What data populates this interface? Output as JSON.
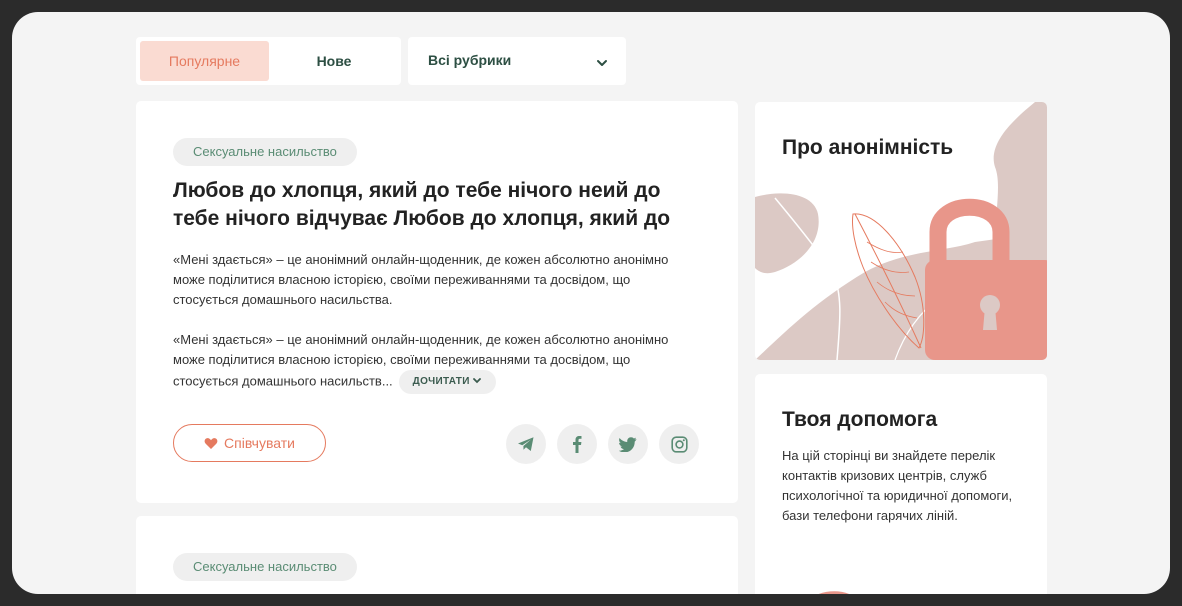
{
  "filters": {
    "tabs": [
      {
        "label": "Популярне",
        "active": true
      },
      {
        "label": "Нове",
        "active": false
      }
    ],
    "category_select": {
      "selected": "Всі рубрики"
    }
  },
  "stories": [
    {
      "tag": "Сексуальне насильство",
      "title": "Любов до хлопця, який до тебе нічого неий до тебе нічого відчуває Любов до хлопця, який до",
      "paragraph_1": "«Мені здається» – це анонімний онлайн-щоденник, де кожен абсолютно анонімно може поділитися власною історією, своїми переживаннями та досвідом, що стосується домашнього насильства.",
      "paragraph_2": "«Мені здається» – це анонімний онлайн-щоденник, де кожен абсолютно анонімно може поділитися власною історією, своїми переживаннями та досвідом, що стосується домашнього насильств...",
      "read_more": "ДОЧИТАТИ",
      "sympathize": "Співчувати"
    },
    {
      "tag": "Сексуальне насильство"
    }
  ],
  "sidebar": {
    "anonymity": {
      "title": "Про анонімність"
    },
    "help": {
      "title": "Твоя допомога",
      "text": "На цій сторінці ви знайдете перелік контактів кризових центрів, служб психологічної та юридичної допомоги, бази телефони гарячих ліній."
    }
  },
  "colors": {
    "accent": "#e57a5f",
    "accent_light": "#fadbd2",
    "green": "#2d4f43",
    "tag_text": "#5a8c74",
    "lock": "#e8968a",
    "blob": "#dcc9c5"
  },
  "icons": [
    "chevron-down-icon",
    "heart-icon",
    "telegram-icon",
    "facebook-icon",
    "twitter-icon",
    "instagram-icon",
    "lock-icon"
  ]
}
